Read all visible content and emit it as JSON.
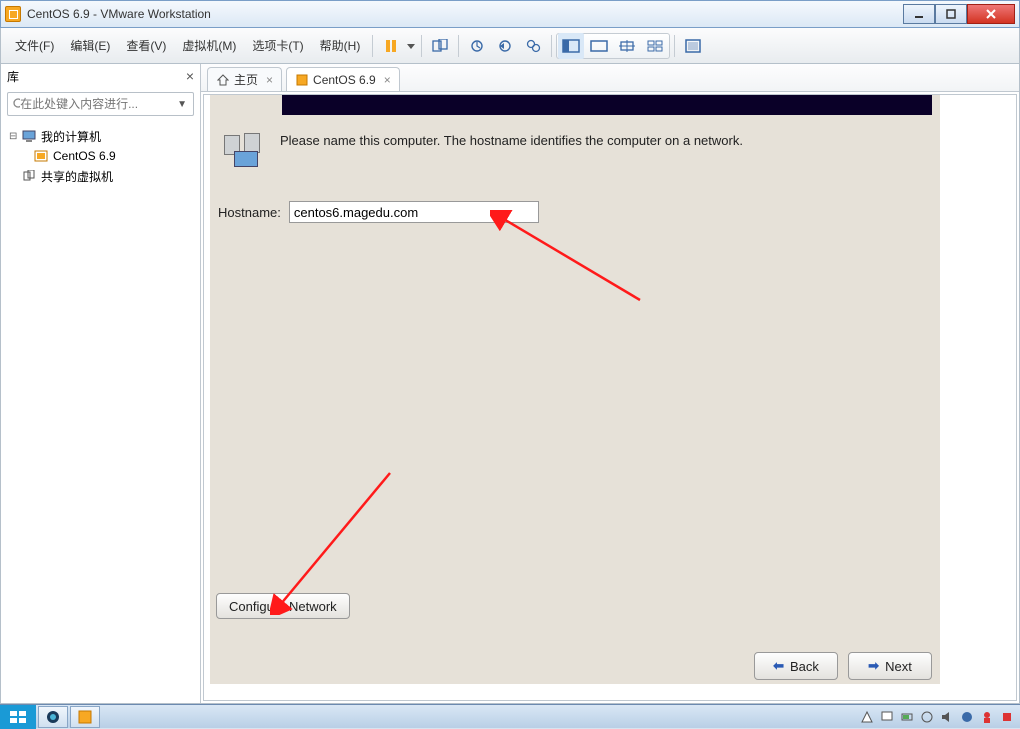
{
  "window": {
    "title": "CentOS 6.9 - VMware Workstation"
  },
  "menu": {
    "items": [
      "文件(F)",
      "编辑(E)",
      "查看(V)",
      "虚拟机(M)",
      "选项卡(T)",
      "帮助(H)"
    ]
  },
  "sidebar": {
    "title": "库",
    "search_placeholder": "在此处键入内容进行...",
    "tree": {
      "root": "我的计算机",
      "child": "CentOS 6.9",
      "shared": "共享的虚拟机"
    }
  },
  "tabs": {
    "home": "主页",
    "vm": "CentOS 6.9"
  },
  "installer": {
    "description": "Please name this computer.  The hostname identifies the computer on a network.",
    "hostname_label": "Hostname:",
    "hostname_value": "centos6.magedu.com",
    "config_network": "Configure Network",
    "back": "Back",
    "next": "Next"
  }
}
